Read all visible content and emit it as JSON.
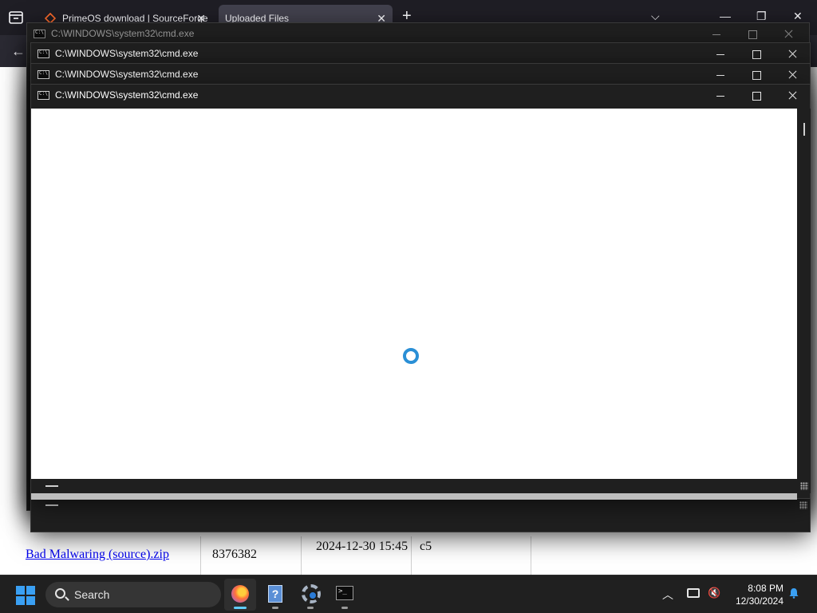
{
  "browser": {
    "tabs": [
      {
        "label": "PrimeOS download | SourceForge",
        "active": false
      },
      {
        "label": "Uploaded Files",
        "active": true
      }
    ],
    "new_tab": "+",
    "file_row": {
      "name": "Bad Malwaring (source).zip",
      "size": "8376382",
      "date": "2024-12-30 15:45",
      "hash": "c5"
    }
  },
  "cmd_windows": [
    {
      "title": "C:\\WINDOWS\\system32\\cmd.exe",
      "focused": false
    },
    {
      "title": "C:\\WINDOWS\\system32\\cmd.exe",
      "focused": true
    },
    {
      "title": "C:\\WINDOWS\\system32\\cmd.exe",
      "focused": true
    },
    {
      "title": "C:\\WINDOWS\\system32\\cmd.exe",
      "focused": true
    }
  ],
  "taskbar": {
    "search_label": "Search",
    "apps": [
      "firefox-icon",
      "help-icon",
      "settings-icon",
      "terminal-icon"
    ],
    "time": "8:08 PM",
    "date": "12/30/2024"
  },
  "colors": {
    "accent": "#60cdff",
    "spinner": "#2a8fd6",
    "link": "#0000ee"
  }
}
